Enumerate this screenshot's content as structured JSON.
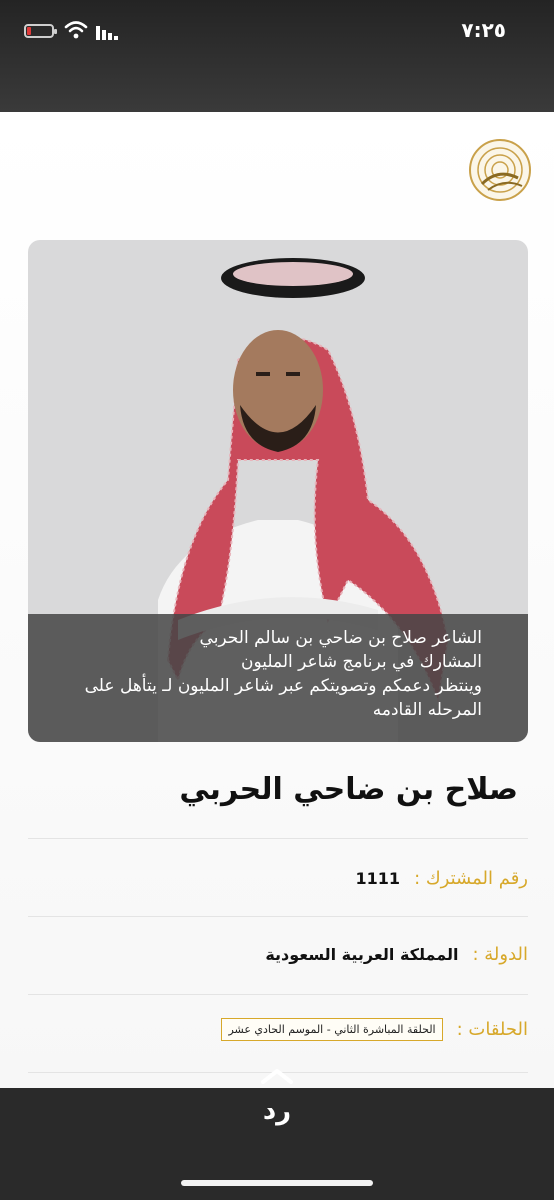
{
  "status_bar": {
    "time": "٧:٢٥",
    "battery_color": "#e03a3a"
  },
  "logo": {
    "icon": "shaer-al-milyon-logo"
  },
  "photo": {
    "caption_lines": [
      "الشاعر صلاح بن ضاحي بن سالم الحربي",
      "المشارك في برنامج شاعر المليون",
      "وينتظر دعمكم وتصويتكم عبر شاعر المليون لـ يتأهل على",
      "المرحله القادمه"
    ]
  },
  "profile": {
    "name": "صلاح بن ضاحي الحربي",
    "rows": [
      {
        "label": "رقم المشترك :",
        "value": "1111"
      },
      {
        "label": "الدولة :",
        "value": "المملكة العربية السعودية"
      },
      {
        "label": "الحلقات :",
        "value": "الحلقة المباشرة الثاني - الموسم الحادي عشر"
      }
    ]
  },
  "reply": {
    "label": "رد",
    "icon": "chevron-up-icon"
  },
  "colors": {
    "accent_gold": "#d7a82a"
  }
}
